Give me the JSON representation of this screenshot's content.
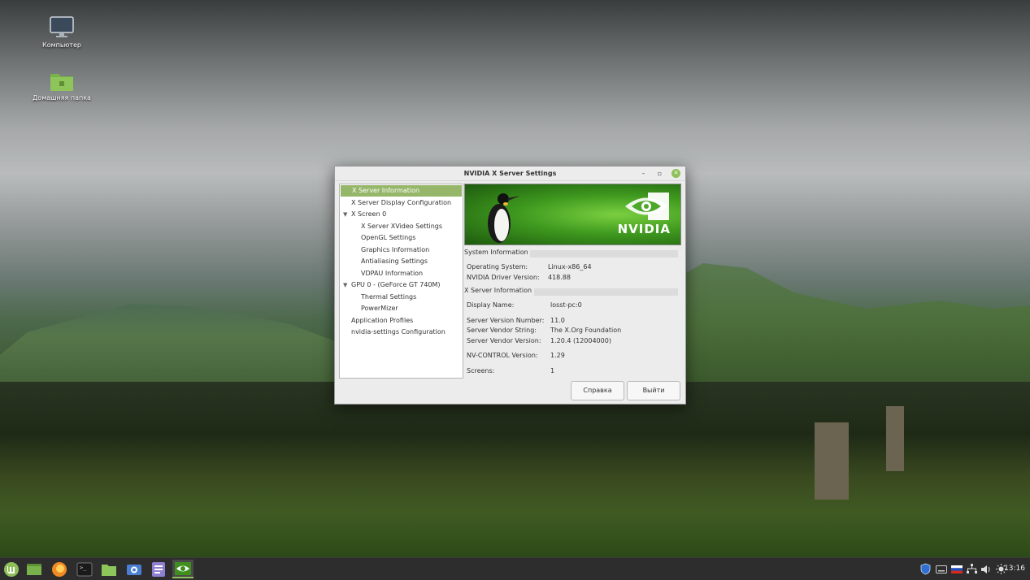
{
  "desktop": {
    "icons": [
      {
        "label": "Компьютер",
        "icon": "monitor-icon"
      },
      {
        "label": "Домашняя папка",
        "icon": "home-folder-icon"
      }
    ]
  },
  "window": {
    "title": "NVIDIA X Server Settings",
    "controls": {
      "minimize": "–",
      "maximize": "▫",
      "close": "✕"
    },
    "tree": [
      {
        "label": "X Server Information",
        "selected": true
      },
      {
        "label": "X Server Display Configuration"
      },
      {
        "label": "X Screen 0",
        "expander": "▼"
      },
      {
        "label": "X Server XVideo Settings"
      },
      {
        "label": "OpenGL Settings"
      },
      {
        "label": "Graphics Information"
      },
      {
        "label": "Antialiasing Settings"
      },
      {
        "label": "VDPAU Information"
      },
      {
        "label": "GPU 0 - (GeForce GT 740M)",
        "expander": "▼"
      },
      {
        "label": "Thermal Settings"
      },
      {
        "label": "PowerMizer"
      },
      {
        "label": "Application Profiles"
      },
      {
        "label": "nvidia-settings Configuration"
      }
    ],
    "banner": {
      "brand": "NVIDIA"
    },
    "system_info": {
      "heading": "System Information",
      "os_label": "Operating System:",
      "os_value": "Linux-x86_64",
      "driver_label": "NVIDIA Driver Version:",
      "driver_value": "418.88"
    },
    "xserver_info": {
      "heading": "X Server Information",
      "display_label": "Display Name:",
      "display_value": "losst-pc:0",
      "version_label": "Server Version Number:",
      "version_value": "11.0",
      "vendor_label": "Server Vendor String:",
      "vendor_value": "The X.Org Foundation",
      "vendor_ver_label": "Server Vendor Version:",
      "vendor_ver_value": "1.20.4 (12004000)",
      "nvcontrol_label": "NV-CONTROL Version:",
      "nvcontrol_value": "1.29",
      "screens_label": "Screens:",
      "screens_value": "1"
    },
    "buttons": {
      "help": "Справка",
      "quit": "Выйти"
    }
  },
  "taskbar": {
    "apps": [
      "mint-menu-icon",
      "show-desktop-icon",
      "firefox-icon",
      "terminal-icon",
      "files-icon",
      "screenshot-icon",
      "text-editor-icon",
      "nvidia-settings-icon"
    ],
    "tray": [
      "shield-icon",
      "keyboard-icon",
      "flag-icon",
      "network-icon",
      "volume-icon",
      "brightness-icon"
    ],
    "clock": "13:16"
  }
}
